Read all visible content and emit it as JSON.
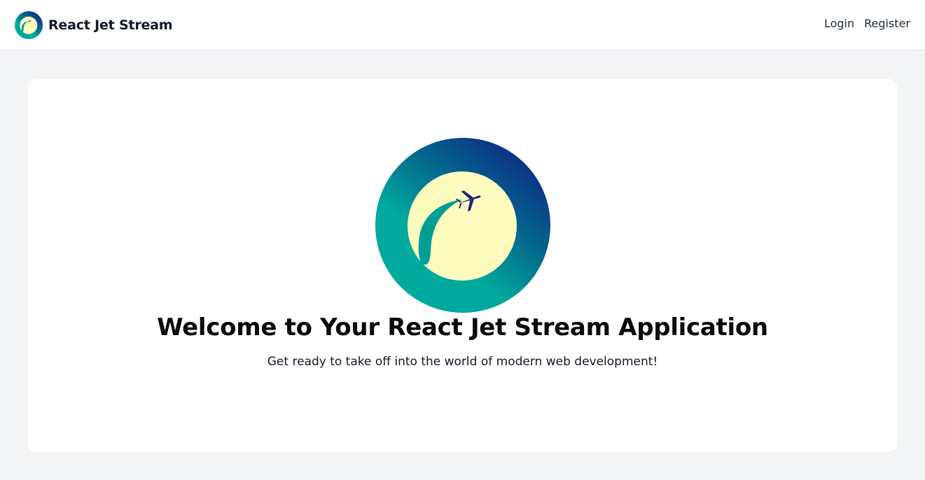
{
  "header": {
    "brand_name": "React Jet Stream",
    "brand_logo_icon": "jet-stream-logo-icon",
    "nav": {
      "login_label": "Login",
      "register_label": "Register"
    }
  },
  "main": {
    "hero_logo_icon": "jet-stream-logo-icon",
    "title": "Welcome to Your React Jet Stream Application",
    "subtitle": "Get ready to take off into the world of modern web development!"
  },
  "colors": {
    "page_background": "#f3f4f6",
    "card_background": "#ffffff",
    "logo_outer_dark": "#0b2e85",
    "logo_outer_teal": "#00a99d",
    "logo_inner_cream": "#fdfcbe",
    "plane": "#1a237e"
  }
}
